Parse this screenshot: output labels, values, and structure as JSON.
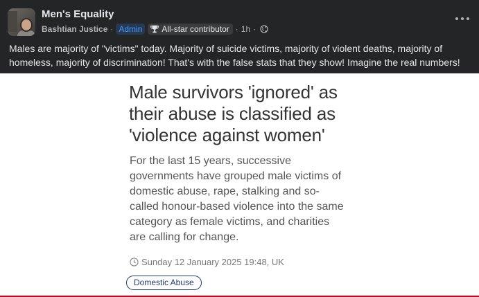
{
  "post": {
    "group_name": "Men's Equality",
    "author": "Bashtian Justice",
    "admin_badge": "Admin",
    "contributor_badge": "All-star contributor",
    "time": "1h",
    "body_text": "Males are majority of \"victims\" today.  Majority of suicide victims, majority of violent deaths, majority of homeless, majority of discrimination!  That's with the false stats that they show!  Imagine the real numbers!",
    "icons": [
      "trophy-icon",
      "globe-icon",
      "more-options-icon"
    ]
  },
  "article": {
    "headline": "Male survivors 'ignored' as their abuse is classified as 'violence against women'",
    "standfirst": "For the last 15 years, successive governments have grouped male victims of domestic abuse, rape, stalking and so-called honour-based violence into the same category as female victims, and charities are calling for change.",
    "timestamp": "Sunday 12 January 2025 19:48, UK",
    "tag": "Domestic Abuse",
    "accent_color": "#d0021b"
  }
}
